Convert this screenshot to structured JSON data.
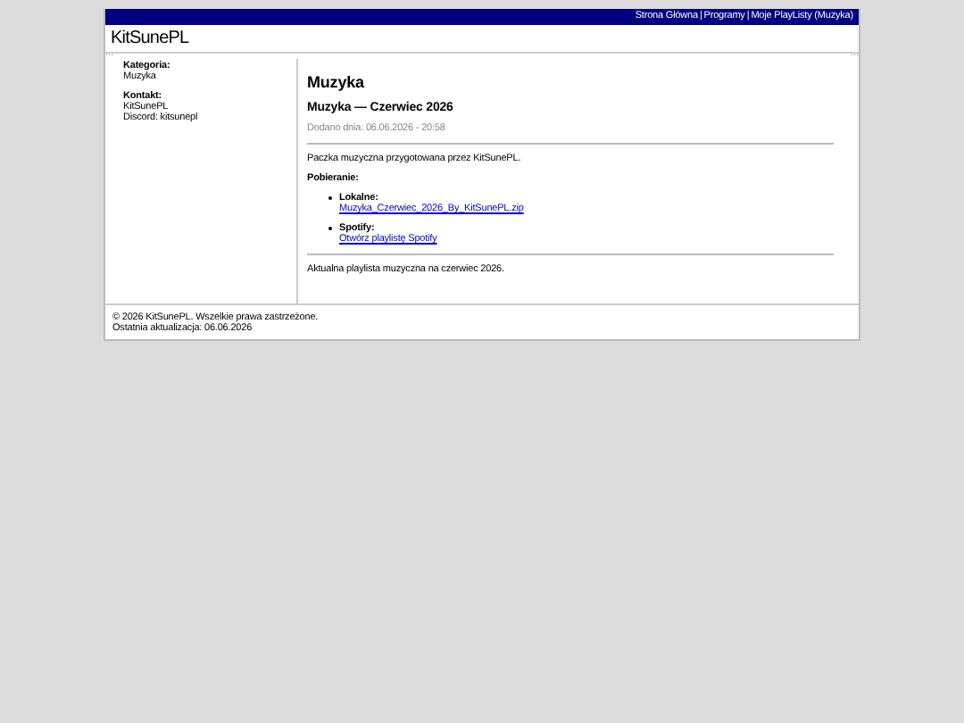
{
  "top_nav": {
    "items": [
      "Strona Główna",
      "Programy",
      "Moje PlayListy (Muzyka)"
    ],
    "separator": "|"
  },
  "header": {
    "title": "KitSunePL"
  },
  "corner_marks": [
    "···",
    "···"
  ],
  "sidebar": {
    "sections": [
      {
        "label": "Kategoria:",
        "lines": [
          "Muzyka"
        ]
      },
      {
        "label": "Kontakt:",
        "lines": [
          "KitSunePL",
          "Discord: kitsunepl"
        ]
      }
    ]
  },
  "content": {
    "heading": "Muzyka",
    "subtitle": "Muzyka — Czerwiec 2026",
    "date": "Dodano dnia: 06.06.2026 - 20:58",
    "intro": "Paczka muzyczna przygotowana przez KitSunePL.",
    "downloads_label": "Pobieranie:",
    "downloads": [
      {
        "label": "Lokalne:",
        "link": "Muzyka_Czerwiec_2026_By_KitSunePL.zip"
      },
      {
        "label": "Spotify:",
        "link": "Otwórz playlistę Spotify"
      }
    ],
    "note": "Aktualna playlista muzyczna na czerwiec 2026."
  },
  "footer": {
    "lines": [
      "© 2026 KitSunePL. Wszelkie prawa zastrzeżone.",
      "Ostatnia aktualizacja: 06.06.2026"
    ]
  }
}
